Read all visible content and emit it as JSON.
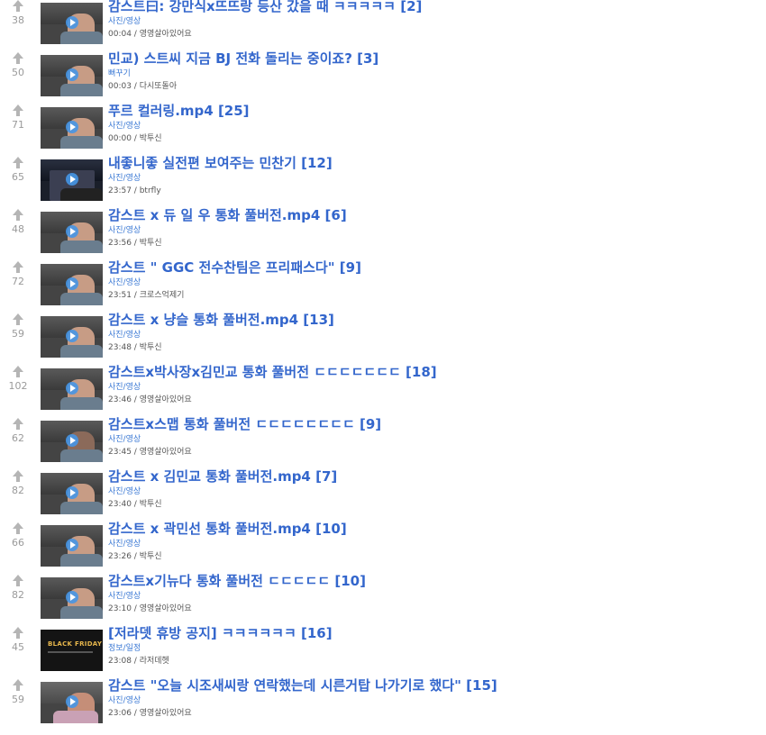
{
  "posts": [
    {
      "score": "38",
      "title": "감스트曰: 강만식x뜨뜨랑 등산 갔을 때 ㅋㅋㅋㅋㅋ [2]",
      "category": "사진/영상",
      "time": "00:04",
      "author": "영영살아있어요",
      "thumb": "person"
    },
    {
      "score": "50",
      "title": "민교) 스트씨 지금 BJ 전화 돌리는 중이죠? [3]",
      "category": "뻐꾸기",
      "time": "00:03",
      "author": "다시또돌아",
      "thumb": "person"
    },
    {
      "score": "71",
      "title": "푸르 컬러링.mp4 [25]",
      "category": "사진/영상",
      "time": "00:00",
      "author": "박투신",
      "thumb": "person"
    },
    {
      "score": "65",
      "title": "내좋니좋 실전편 보여주는 민찬기 [12]",
      "category": "사진/영상",
      "time": "23:57",
      "author": "btrfly",
      "thumb": "night"
    },
    {
      "score": "48",
      "title": "감스트 x 듀 일 우 통화 풀버전.mp4 [6]",
      "category": "사진/영상",
      "time": "23:56",
      "author": "박투신",
      "thumb": "person"
    },
    {
      "score": "72",
      "title": "감스트 \" GGC 전수찬팀은 프리패스다\" [9]",
      "category": "사진/영상",
      "time": "23:51",
      "author": "크로스억제기",
      "thumb": "person"
    },
    {
      "score": "59",
      "title": "감스트 x 냥슬 통화 풀버전.mp4 [13]",
      "category": "사진/영상",
      "time": "23:48",
      "author": "박투신",
      "thumb": "person"
    },
    {
      "score": "102",
      "title": "감스트x박사장x김민교 통화 풀버전 ㄷㄷㄷㄷㄷㄷㄷ [18]",
      "category": "사진/영상",
      "time": "23:46",
      "author": "영영살아있어요",
      "thumb": "person"
    },
    {
      "score": "62",
      "title": "감스트x스맵 통화 풀버전 ㄷㄷㄷㄷㄷㄷㄷㄷ [9]",
      "category": "사진/영상",
      "time": "23:45",
      "author": "영영살아있어요",
      "thumb": "dark"
    },
    {
      "score": "82",
      "title": "감스트 x 김민교 통화 풀버전.mp4 [7]",
      "category": "사진/영상",
      "time": "23:40",
      "author": "박투신",
      "thumb": "person"
    },
    {
      "score": "66",
      "title": "감스트 x 곽민선 통화 풀버전.mp4 [10]",
      "category": "사진/영상",
      "time": "23:26",
      "author": "박투신",
      "thumb": "person"
    },
    {
      "score": "82",
      "title": "감스트x기뉴다 통화 풀버전 ㄷㄷㄷㄷㄷ [10]",
      "category": "사진/영상",
      "time": "23:10",
      "author": "영영살아있어요",
      "thumb": "person"
    },
    {
      "score": "45",
      "title": "[저라뎃 휴방 공지] ㅋㅋㅋㅋㅋㅋ [16]",
      "category": "정보/일정",
      "time": "23:08",
      "author": "라저데헷",
      "thumb": "notice",
      "thumb_text": "BLACK FRIDAY"
    },
    {
      "score": "59",
      "title": "감스트 \"오늘 시조새씨랑 연락했는데 시른거탑 나가기로 했다\" [15]",
      "category": "사진/영상",
      "time": "23:06",
      "author": "영영살아있어요",
      "thumb": "pink"
    }
  ],
  "colors": {
    "title": "#3366cc",
    "category": "#3a78d4",
    "upvote_arrow": "#b5b5b5"
  },
  "icons": {
    "upvote": "upvote-arrow-icon",
    "play": "play-icon"
  }
}
